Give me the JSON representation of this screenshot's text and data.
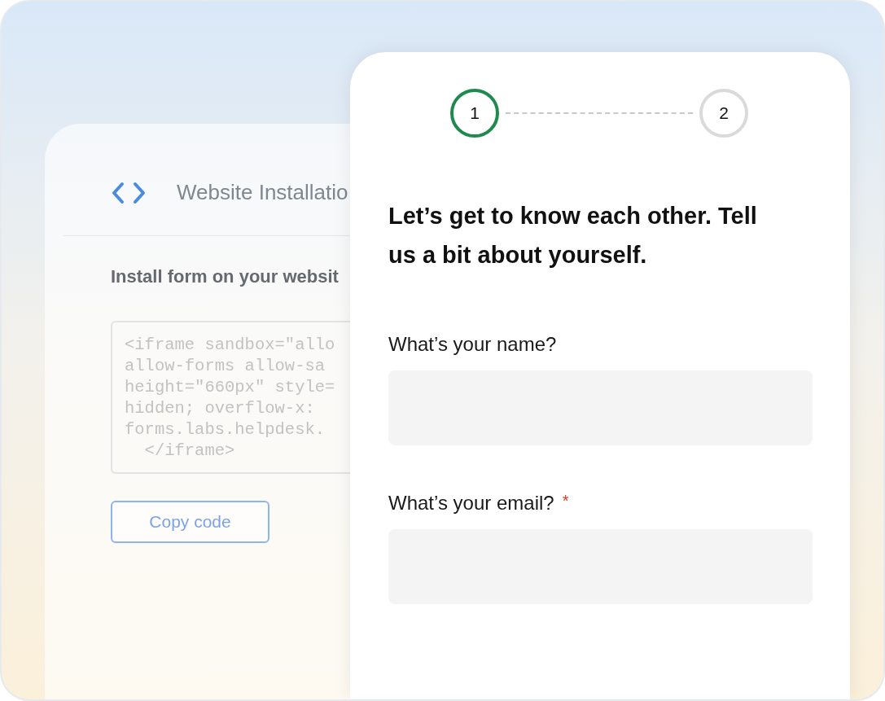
{
  "installation_panel": {
    "title": "Website Installatio",
    "subtitle": "Install form on your websit",
    "code_lines": [
      "<iframe sandbox=\"allo",
      "allow-forms allow-sa",
      "height=\"660px\" style=",
      "hidden; overflow-x: ",
      "forms.labs.helpdesk.",
      "  </iframe>"
    ],
    "copy_button": "Copy code"
  },
  "form": {
    "steps": [
      {
        "number": "1",
        "selected": true
      },
      {
        "number": "2",
        "selected": false
      }
    ],
    "heading": "Let’s get to know each other. Tell us a bit about yourself.",
    "fields": [
      {
        "label": "What’s your name?"
      },
      {
        "label": "What’s your email?",
        "required_mark": "*"
      }
    ]
  }
}
